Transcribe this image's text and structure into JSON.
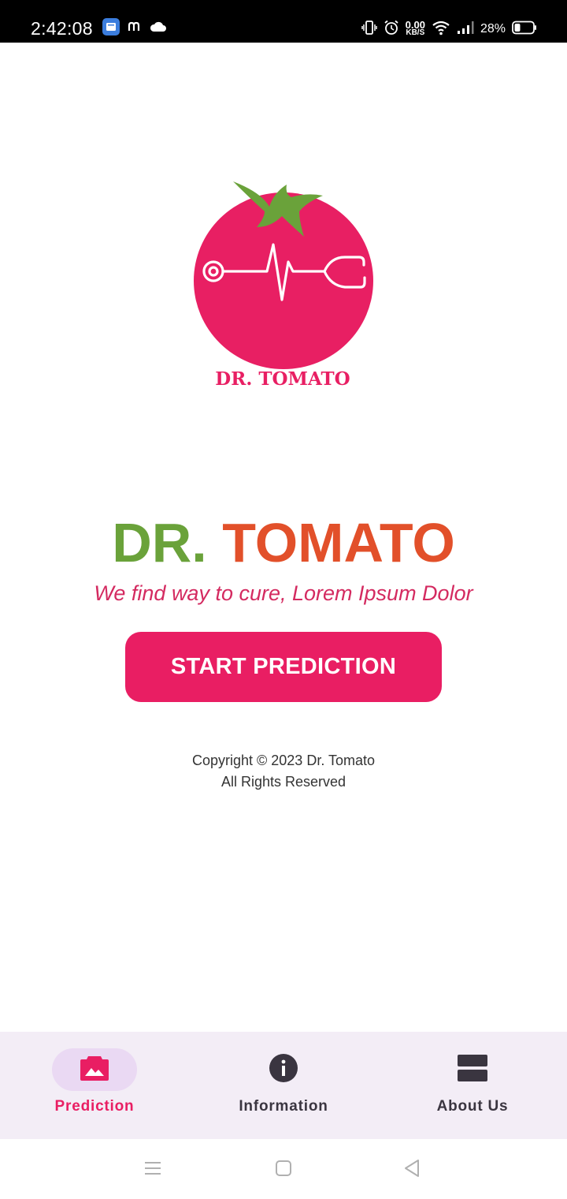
{
  "status_bar": {
    "time": "2:42:08",
    "net_speed_value": "0.00",
    "net_speed_unit": "KB/S",
    "battery": "28%"
  },
  "logo": {
    "text": "DR. TOMATO"
  },
  "hero": {
    "title_part1": "DR.",
    "title_part2": "TOMATO",
    "tagline": "We find way to cure, Lorem Ipsum Dolor",
    "start_button": "START PREDICTION"
  },
  "footer": {
    "copyright_line1": "Copyright © 2023 Dr. Tomato",
    "copyright_line2": "All Rights Reserved"
  },
  "bottom_nav": {
    "items": [
      {
        "label": "Prediction",
        "icon": "image-icon",
        "active": true
      },
      {
        "label": "Information",
        "icon": "info-icon",
        "active": false
      },
      {
        "label": "About Us",
        "icon": "view-agenda-icon",
        "active": false
      }
    ]
  },
  "colors": {
    "accent": "#e91e63",
    "title_green": "#6aa23a",
    "title_orange": "#e2502a",
    "nav_background": "#f3edf6",
    "nav_indicator": "#ead9f3"
  }
}
